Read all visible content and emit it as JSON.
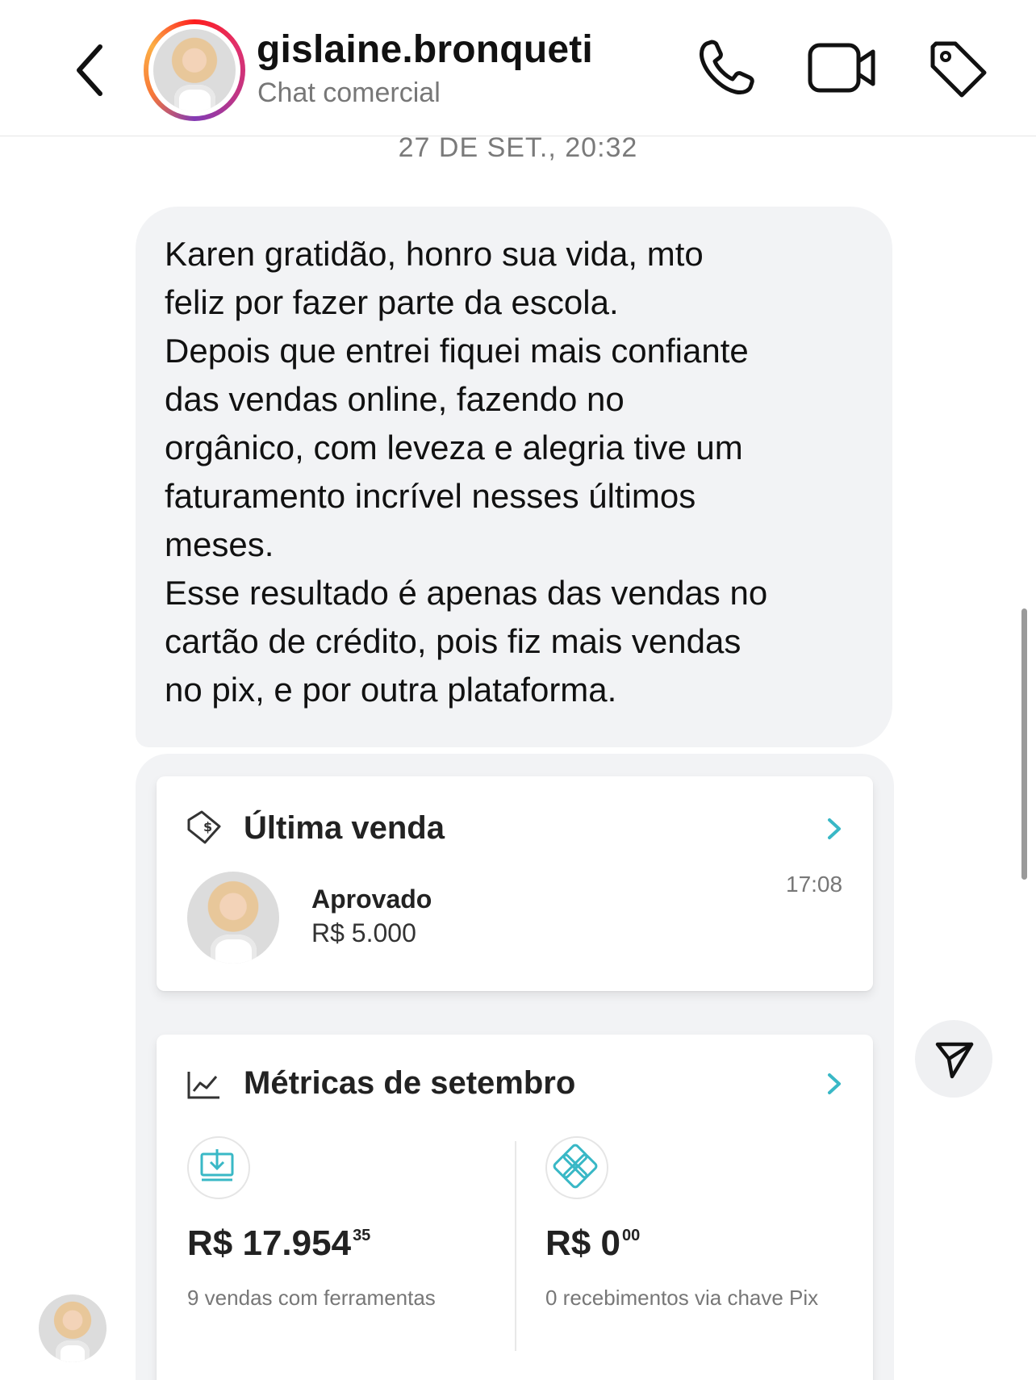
{
  "header": {
    "username": "gislaine.bronqueti",
    "subtitle": "Chat comercial",
    "icons": [
      "back-icon",
      "phone-icon",
      "video-icon",
      "tag-icon"
    ]
  },
  "thread": {
    "timestamp": "27 DE SET., 20:32",
    "message": "Karen gratidão, honro sua vida, mto\nfeliz por fazer parte da escola.\nDepois que entrei fiquei mais confiante\ndas vendas online, fazendo no\norgânico, com leveza e alegria tive um\nfaturamento incrível nesses últimos\nmeses.\nEsse resultado é apenas das vendas no\ncartão de crédito, pois fiz mais vendas\nno pix, e por outra plataforma."
  },
  "screenshot": {
    "last_sale": {
      "title": "Última venda",
      "status": "Aprovado",
      "amount": "R$ 5.000",
      "time": "17:08"
    },
    "metrics": {
      "title": "Métricas de setembro",
      "left": {
        "value_main": "R$ 17.954",
        "value_cents": "35",
        "caption": "9 vendas com ferramentas"
      },
      "right": {
        "value_main": "R$ 0",
        "value_cents": "00",
        "caption": "0 recebimentos via chave Pix"
      }
    }
  },
  "colors": {
    "story_ring": [
      "#fd1d1d",
      "#e1306c",
      "#833ab4",
      "#fcaf45"
    ],
    "accent_teal": "#39b8c6",
    "bubble_bg": "#f2f3f5"
  }
}
